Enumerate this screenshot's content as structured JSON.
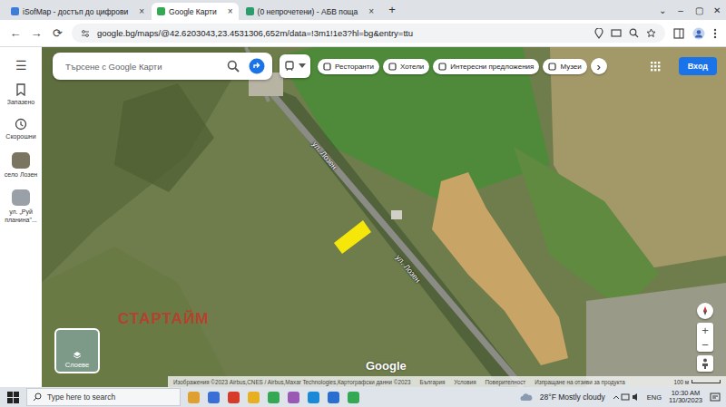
{
  "tabs": [
    {
      "label": "iSofMap - достъп до цифрови",
      "selected": false,
      "close": "×"
    },
    {
      "label": "Google Карти",
      "selected": true,
      "close": "×"
    },
    {
      "label": "(0 непрочетени) - АБВ поща",
      "selected": false,
      "close": "×"
    }
  ],
  "new_tab": "+",
  "window_controls": [
    "⌄",
    "–",
    "▢",
    "✕"
  ],
  "nav_buttons": [
    "←",
    "→",
    "⟳"
  ],
  "address_bar": {
    "url": "google.bg/maps/@42.6203043,23.4531306,652m/data=!3m1!1e3?hl=bg&entry=ttu"
  },
  "sidebar": {
    "menu": "☰",
    "items": [
      {
        "label": "Запазено",
        "kind": "icon"
      },
      {
        "label": "Скорошни",
        "kind": "icon"
      },
      {
        "label": "село Лозен",
        "kind": "thumb"
      },
      {
        "label": "ул. „Руй планина\"...",
        "kind": "thumb"
      }
    ]
  },
  "search": {
    "placeholder": "Търсене с Google Карти"
  },
  "chips": [
    "Ресторанти",
    "Хотели",
    "Интересни предложения",
    "Музеи"
  ],
  "chips_more": "›",
  "sign_in": "Вход",
  "map": {
    "road_labels": [
      "ул. Лозен",
      "ул. Лозен"
    ],
    "watermark": "СТАРТАЙМ",
    "logo": "Google",
    "layers": "Слоеве",
    "zoom": [
      "+",
      "−"
    ]
  },
  "attribution": [
    "Изображения ©2023 Airbus,CNES / Airbus,Maxar Technologies,Картографски данни ©2023",
    "България",
    "Условия",
    "Поверителност",
    "Изпращане на отзиви за продукта"
  ],
  "scale": "100 м",
  "taskbar": {
    "search": "Type here to search",
    "weather": "28°F Mostly cloudy",
    "lang": "ENG",
    "time": "10:30 AM",
    "date": "11/30/2023"
  }
}
